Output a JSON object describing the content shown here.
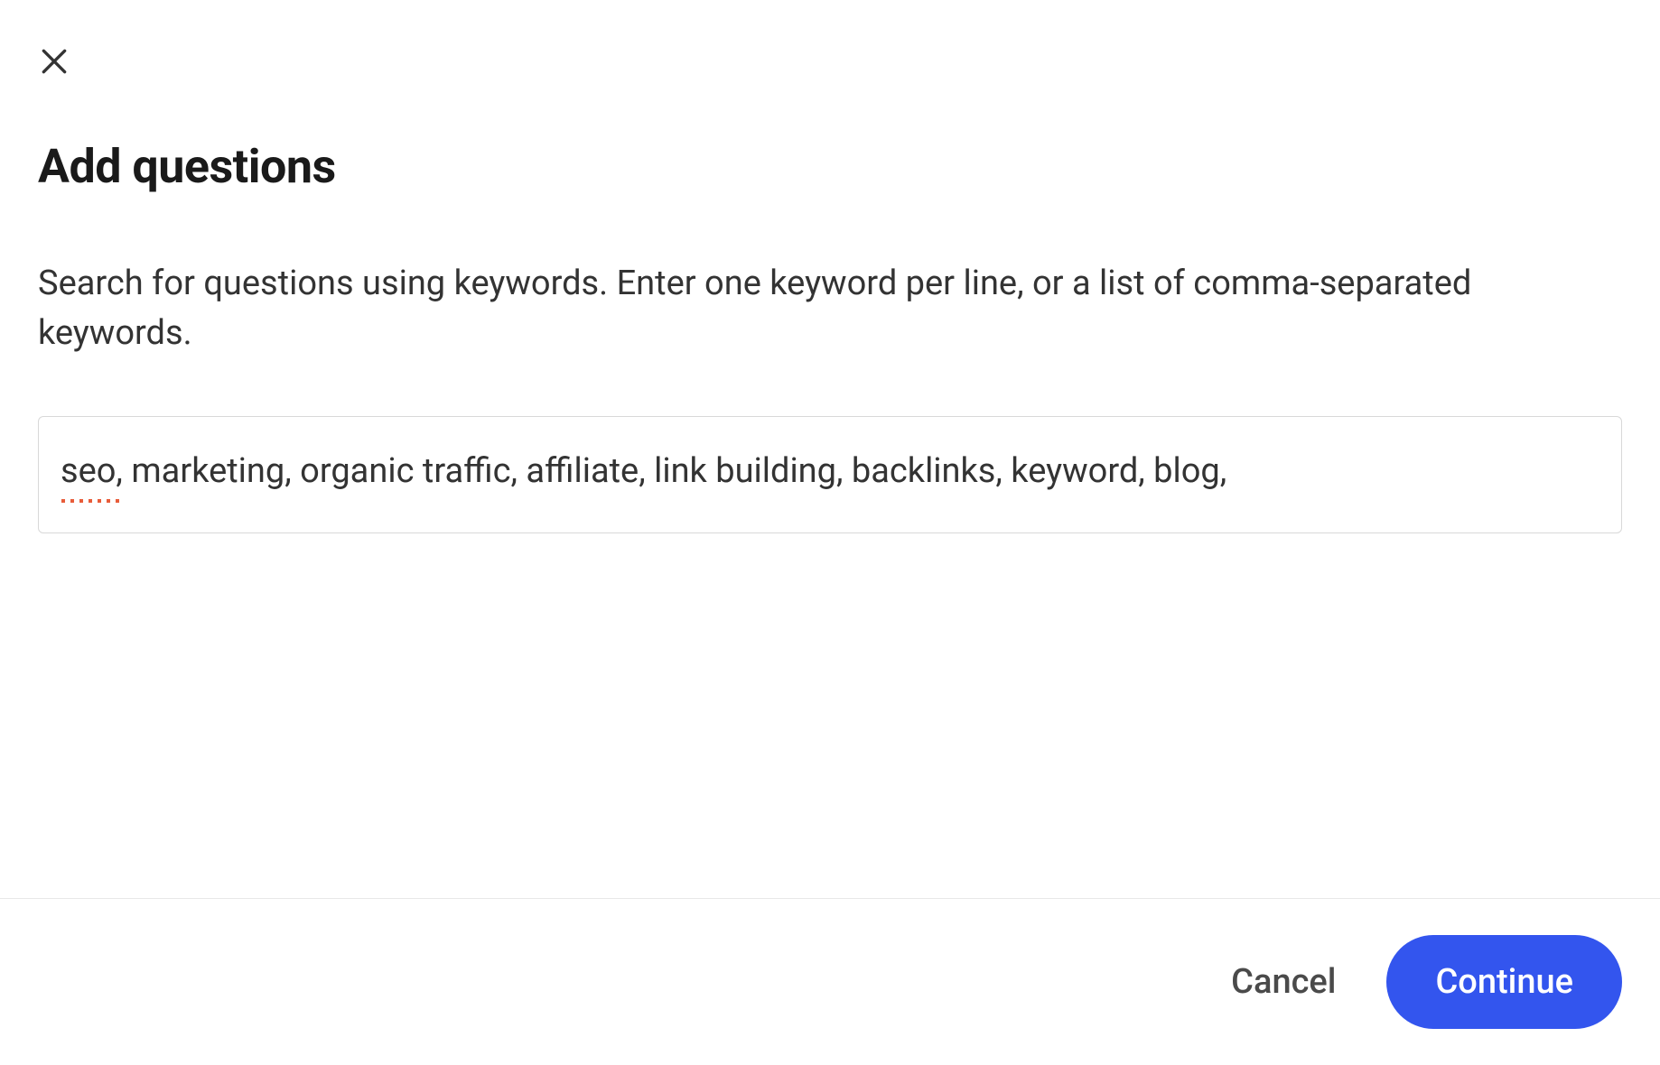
{
  "dialog": {
    "title": "Add questions",
    "description": "Search for questions using keywords. Enter one keyword per line, or a list of comma-separated keywords.",
    "input_value": "seo, marketing, organic traffic, affiliate, link building, backlinks, keyword, blog,",
    "spellcheck_word": "seo"
  },
  "footer": {
    "cancel_label": "Cancel",
    "continue_label": "Continue"
  }
}
